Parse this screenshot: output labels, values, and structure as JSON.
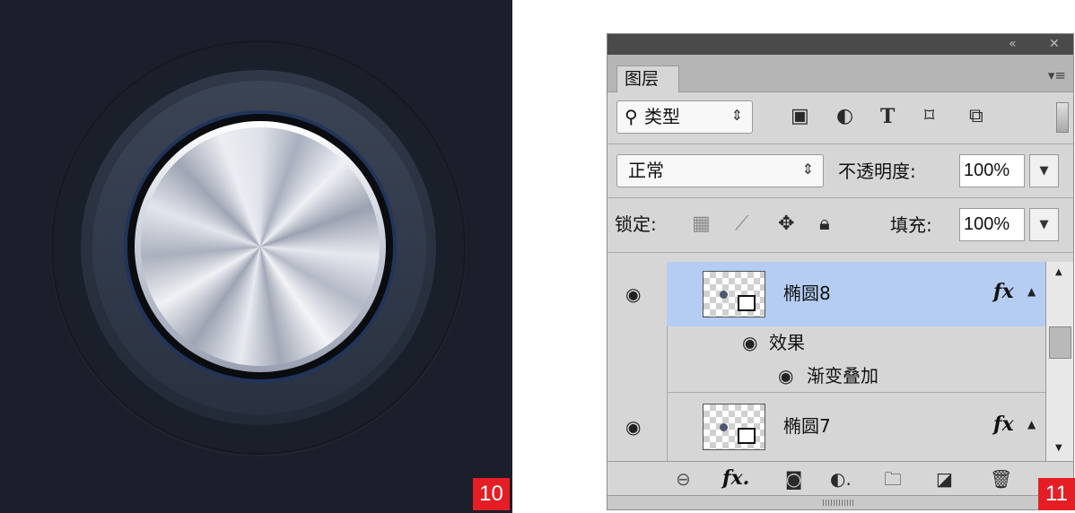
{
  "figure_badges": {
    "left": "10",
    "right": "11"
  },
  "panel": {
    "tab_label": "图层",
    "collapse_icon": "double-chevron-icon",
    "close_icon": "close-icon",
    "menu_icon": "panel-menu-icon",
    "filter": {
      "label": "类型",
      "search_icon": "search-icon"
    },
    "filter_icons": [
      "image-filter-icon",
      "adjustment-filter-icon",
      "type-filter-icon",
      "shape-filter-icon",
      "smart-object-filter-icon"
    ],
    "blend_mode": "正常",
    "opacity_label": "不透明度:",
    "opacity_value": "100%",
    "lock_label": "锁定:",
    "lock_icons": [
      "lock-transparent-icon",
      "lock-paint-icon",
      "lock-position-icon",
      "lock-all-icon"
    ],
    "fill_label": "填充:",
    "fill_value": "100%",
    "layers": [
      {
        "name": "椭圆8",
        "selected": true,
        "fx": "fx",
        "effects_label": "效果",
        "effects": [
          "渐变叠加"
        ]
      },
      {
        "name": "椭圆7",
        "selected": false,
        "fx": "fx"
      }
    ],
    "bottom_icons": [
      "link-layers-icon",
      "fx-icon",
      "mask-icon",
      "adjustment-layer-icon",
      "group-folder-icon",
      "new-layer-icon",
      "trash-icon"
    ]
  },
  "colors": {
    "canvas_bg": "#1b1f2b",
    "selection": "#b6cdf3",
    "badge": "#e51e25"
  }
}
